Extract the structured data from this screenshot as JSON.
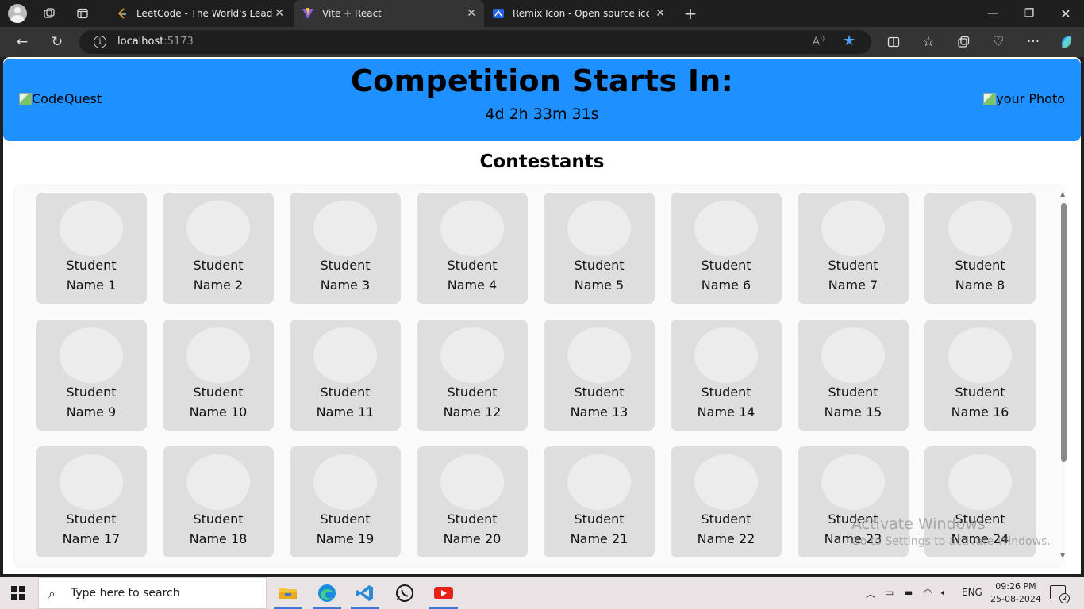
{
  "browser": {
    "tabs": [
      {
        "title": "LeetCode - The World's Leading Online Programming Learning Platform",
        "active": false
      },
      {
        "title": "Vite + React",
        "active": true
      },
      {
        "title": "Remix Icon - Open source icon library",
        "active": false
      }
    ],
    "address": {
      "host": "localhost",
      "port": ":5173"
    },
    "read_aloud": "A⁾"
  },
  "header": {
    "logo_alt": "CodeQuest",
    "title": "Competition Starts In:",
    "countdown": "4d 2h 33m 31s",
    "photo_alt": "your Photo"
  },
  "contestants": {
    "title": "Contestants",
    "cards": [
      {
        "first": "Student",
        "second": "Name 1"
      },
      {
        "first": "Student",
        "second": "Name 2"
      },
      {
        "first": "Student",
        "second": "Name 3"
      },
      {
        "first": "Student",
        "second": "Name 4"
      },
      {
        "first": "Student",
        "second": "Name 5"
      },
      {
        "first": "Student",
        "second": "Name 6"
      },
      {
        "first": "Student",
        "second": "Name 7"
      },
      {
        "first": "Student",
        "second": "Name 8"
      },
      {
        "first": "Student",
        "second": "Name 9"
      },
      {
        "first": "Student",
        "second": "Name 10"
      },
      {
        "first": "Student",
        "second": "Name 11"
      },
      {
        "first": "Student",
        "second": "Name 12"
      },
      {
        "first": "Student",
        "second": "Name 13"
      },
      {
        "first": "Student",
        "second": "Name 14"
      },
      {
        "first": "Student",
        "second": "Name 15"
      },
      {
        "first": "Student",
        "second": "Name 16"
      },
      {
        "first": "Student",
        "second": "Name 17"
      },
      {
        "first": "Student",
        "second": "Name 18"
      },
      {
        "first": "Student",
        "second": "Name 19"
      },
      {
        "first": "Student",
        "second": "Name 20"
      },
      {
        "first": "Student",
        "second": "Name 21"
      },
      {
        "first": "Student",
        "second": "Name 22"
      },
      {
        "first": "Student",
        "second": "Name 23"
      },
      {
        "first": "Student",
        "second": "Name 24"
      }
    ]
  },
  "watermark": {
    "line1": "Activate Windows",
    "line2": "Go to Settings to activate Windows."
  },
  "taskbar": {
    "search_placeholder": "Type here to search",
    "apps": [
      "file-explorer-icon",
      "edge-icon",
      "vscode-icon",
      "whatsapp-icon",
      "youtube-icon"
    ],
    "language": "ENG",
    "time": "09:26 PM",
    "date": "25-08-2024",
    "notification_count": "2"
  },
  "colors": {
    "header_bg": "#1e90ff",
    "card_bg": "#dedede",
    "avatar_bg": "#ececec"
  }
}
